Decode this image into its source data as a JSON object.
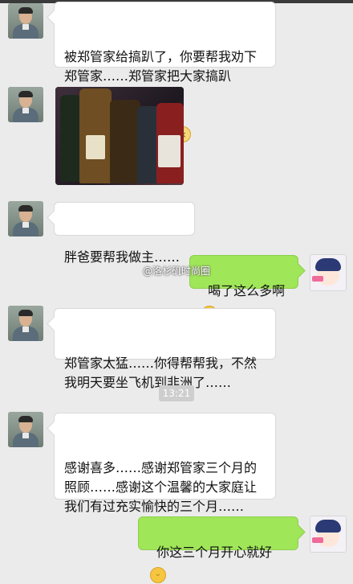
{
  "messages": {
    "m1": {
      "text": "被郑管家给搞趴了，你要帮我劝下郑管家……郑管家把大家搞趴",
      "emojis": [
        "😫",
        "😫",
        "😫",
        "😫",
        "😵",
        "😵",
        "😵",
        "😵"
      ]
    },
    "m3": {
      "text": "胖爸要帮我做主……"
    },
    "m4": {
      "text": "喝了这么多啊",
      "emoji": "😂"
    },
    "m5": {
      "text": "郑管家太猛……你得帮帮我，不然我明天要坐飞机到非洲了……"
    },
    "timestamp": "13:21",
    "m6": {
      "text": "感谢喜多……感谢郑管家三个月的照顾……感谢这个温馨的大家庭让我们有过充实愉快的三个月……"
    },
    "m7": {
      "text": "你这三个月开心就好",
      "emoji": "😄"
    }
  },
  "watermark": "@洛杉矶时尚圈",
  "photo_label": "photo of liquor bottles on a table"
}
